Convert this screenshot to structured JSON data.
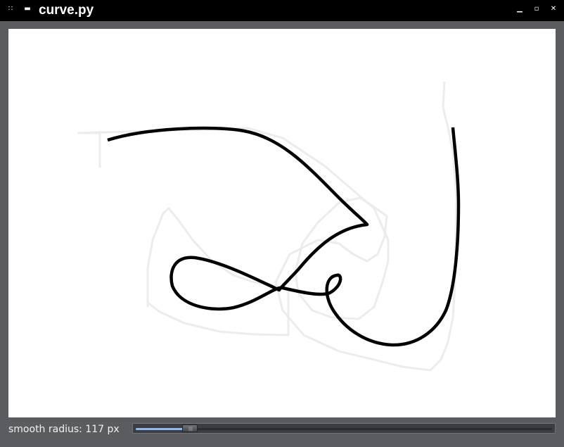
{
  "window": {
    "title": "curve.py",
    "icons": [
      "menu-icon",
      "shade-icon",
      "minimize-icon",
      "maximize-icon",
      "close-icon"
    ]
  },
  "status": {
    "label": "smooth radius: 117 px"
  },
  "slider": {
    "fraction": 0.13,
    "fill_color": "#8fb8ef"
  },
  "colors": {
    "frame": "#5b5c5f",
    "canvas": "#ffffff",
    "curve": "#000000",
    "raw_stroke": "#ececec"
  }
}
